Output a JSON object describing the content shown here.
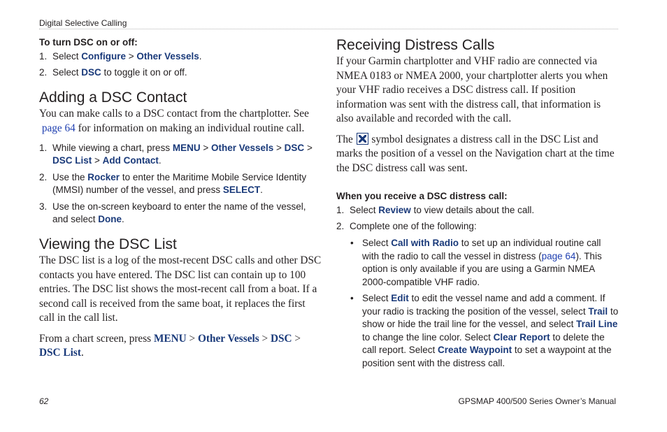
{
  "header": {
    "section": "Digital Selective Calling"
  },
  "left": {
    "turn": {
      "heading": "To turn DSC on or off:",
      "s1": {
        "num": "1.",
        "t1": "Select ",
        "b1": "Configure",
        "t2": " > ",
        "b2": "Other Vessels",
        "t3": "."
      },
      "s2": {
        "num": "2.",
        "t1": "Select ",
        "b1": "DSC",
        "t2": " to toggle it on or off."
      }
    },
    "adding": {
      "title": "Adding a DSC Contact",
      "p1": "You can make calls to a DSC contact from the chartplotter. See",
      "p1_link": "page 64",
      "p1_rest": " for information on making an individual routine call.",
      "s1": {
        "num": "1.",
        "t1": "While viewing a chart, press ",
        "b1": "MENU",
        "t2": " > ",
        "b2": "Other Vessels",
        "t3": " > ",
        "b3": "DSC",
        "t4": " > ",
        "b4": "DSC List",
        "t5": " > ",
        "b5": "Add Contact",
        "t6": "."
      },
      "s2": {
        "num": "2.",
        "t1": "Use the ",
        "b1": "Rocker",
        "t2": " to enter the Maritime Mobile Service Identity (MMSI) number of the vessel, and press ",
        "b2": "SELECT",
        "t3": "."
      },
      "s3": {
        "num": "3.",
        "t1": "Use the on-screen keyboard to enter the name of the vessel, and select ",
        "b1": "Done",
        "t2": "."
      }
    },
    "viewing": {
      "title": "Viewing the DSC List",
      "p1": "The DSC list is a log of the most-recent DSC calls and other DSC contacts you have entered. The DSC list can contain up to 100 entries. The DSC list shows the most-recent call from a boat. If a second call is received from the same boat, it replaces the first call in the call list.",
      "p2": {
        "t1": "From a chart screen, press ",
        "b1": "MENU",
        "t2": " > ",
        "b2": "Other Vessels",
        "t3": " > ",
        "b3": "DSC",
        "t4": " > ",
        "b4": "DSC List",
        "t5": "."
      }
    }
  },
  "right": {
    "title": "Receiving Distress Calls",
    "p1": "If your Garmin chartplotter and VHF radio are connected via NMEA 0183 or NMEA 2000, your chartplotter alerts you when your VHF radio receives a DSC distress call. If position information was sent with the distress call, that information is also available and recorded with the call.",
    "p2a": "The ",
    "p2_icon": "distress-call-icon",
    "p2b": " symbol designates a distress call in the DSC List and marks the position of a vessel on the Navigation chart at the time the DSC distress call was sent.",
    "when_heading": "When you receive a DSC distress call:",
    "s1": {
      "num": "1.",
      "t1": "Select ",
      "b1": "Review",
      "t2": " to view details about the call."
    },
    "s2": {
      "num": "2.",
      "t1": "Complete one of the following:"
    },
    "bullet1": {
      "dot": "•",
      "t1": "Select ",
      "b1": "Call with Radio",
      "t2": " to set up an individual routine call with the radio to call the vessel in distress (",
      "link": "page 64",
      "t3": "). This option is only available if you are using a Garmin NMEA 2000-compatible VHF radio."
    },
    "bullet2": {
      "dot": "•",
      "t1": "Select ",
      "b1": "Edit",
      "t2": " to edit the vessel name and add a comment. If your radio is tracking the position of the vessel, select ",
      "b2": "Trail",
      "t3": " to show or hide the trail line for the vessel, and select ",
      "b3": "Trail Line",
      "t4": " to change the line color. Select ",
      "b4": "Clear Report",
      "t5": " to delete the call report. Select ",
      "b5": "Create Waypoint",
      "t6": " to set a waypoint at the position sent with the distress call."
    }
  },
  "footer": {
    "page": "62",
    "manual": "GPSMAP 400/500 Series Owner’s Manual"
  },
  "colors": {
    "keyword": "#1a3a7a",
    "link": "#1f3fb0",
    "text": "#231f20"
  }
}
